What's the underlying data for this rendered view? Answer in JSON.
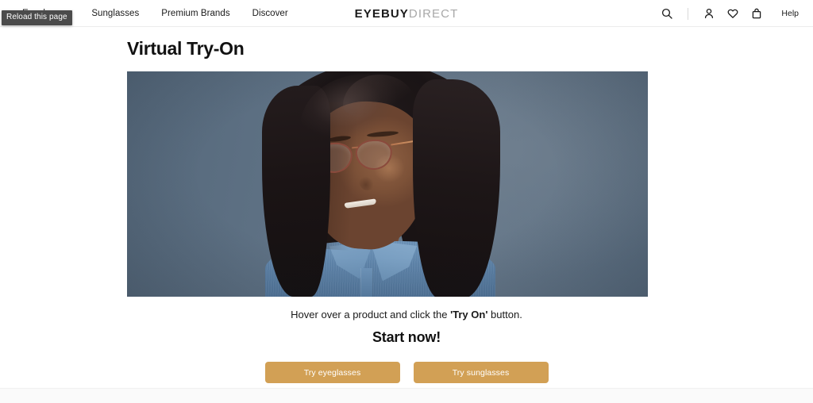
{
  "browser": {
    "tooltip_text": "Reload this page"
  },
  "header": {
    "nav_items": [
      {
        "label": "Eyeglasses",
        "name": "nav-eyeglasses"
      },
      {
        "label": "Sunglasses",
        "name": "nav-sunglasses"
      },
      {
        "label": "Premium Brands",
        "name": "nav-premium-brands"
      },
      {
        "label": "Discover",
        "name": "nav-discover"
      }
    ],
    "logo": {
      "part_one": "EYEBUY",
      "part_two": "DIRECT"
    },
    "icons": [
      {
        "name": "search-icon",
        "label": "Search"
      },
      {
        "name": "account-icon",
        "label": "Account"
      },
      {
        "name": "wishlist-heart-icon",
        "label": "Wishlist"
      },
      {
        "name": "shopping-bag-icon",
        "label": "Cart"
      }
    ],
    "help_label": "Help"
  },
  "main": {
    "page_title": "Virtual Try-On",
    "hero_alt": "Woman wearing eyeglasses against a slate blue background",
    "caption_before": "Hover over a product and click the ",
    "caption_strong": "'Try On'",
    "caption_after": " button.",
    "start_now": "Start now!",
    "cta_buttons": [
      {
        "label": "Try eyeglasses",
        "name": "try-eyeglasses-button"
      },
      {
        "label": "Try sunglasses",
        "name": "try-sunglasses-button"
      }
    ]
  },
  "colors": {
    "cta_background": "#d2a055",
    "cta_text": "#ffffff",
    "hero_background": "#5f7285",
    "text_primary": "#1a1a1a",
    "logo_secondary": "#a8a8a8",
    "tooltip_background": "#4b4b4b"
  }
}
